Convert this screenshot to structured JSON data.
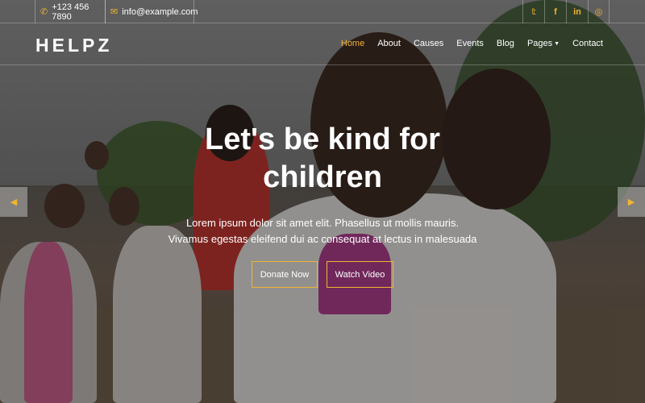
{
  "topbar": {
    "phone": "+123 456 7890",
    "email": "info@example.com",
    "social": [
      {
        "icon": "twitter-icon",
        "glyph": "𝕥"
      },
      {
        "icon": "facebook-icon",
        "glyph": "f"
      },
      {
        "icon": "linkedin-icon",
        "glyph": "in"
      },
      {
        "icon": "instagram-icon",
        "glyph": "◎"
      }
    ]
  },
  "brand": {
    "logo": "HELPZ"
  },
  "nav": {
    "items": [
      "Home",
      "About",
      "Causes",
      "Events",
      "Blog",
      "Pages",
      "Contact"
    ],
    "active": "Home"
  },
  "hero": {
    "title_line1": "Let's be kind for",
    "title_line2": "children",
    "text": "Lorem ipsum dolor sit amet elit. Phasellus ut mollis mauris. Vivamus egestas eleifend dui ac consequat at lectus in malesuada",
    "donate_label": "Donate Now",
    "video_label": "Watch Video"
  },
  "carousel": {
    "prev_icon": "chevron-left-icon",
    "next_icon": "chevron-right-icon"
  },
  "colors": {
    "accent": "#f0b531"
  }
}
